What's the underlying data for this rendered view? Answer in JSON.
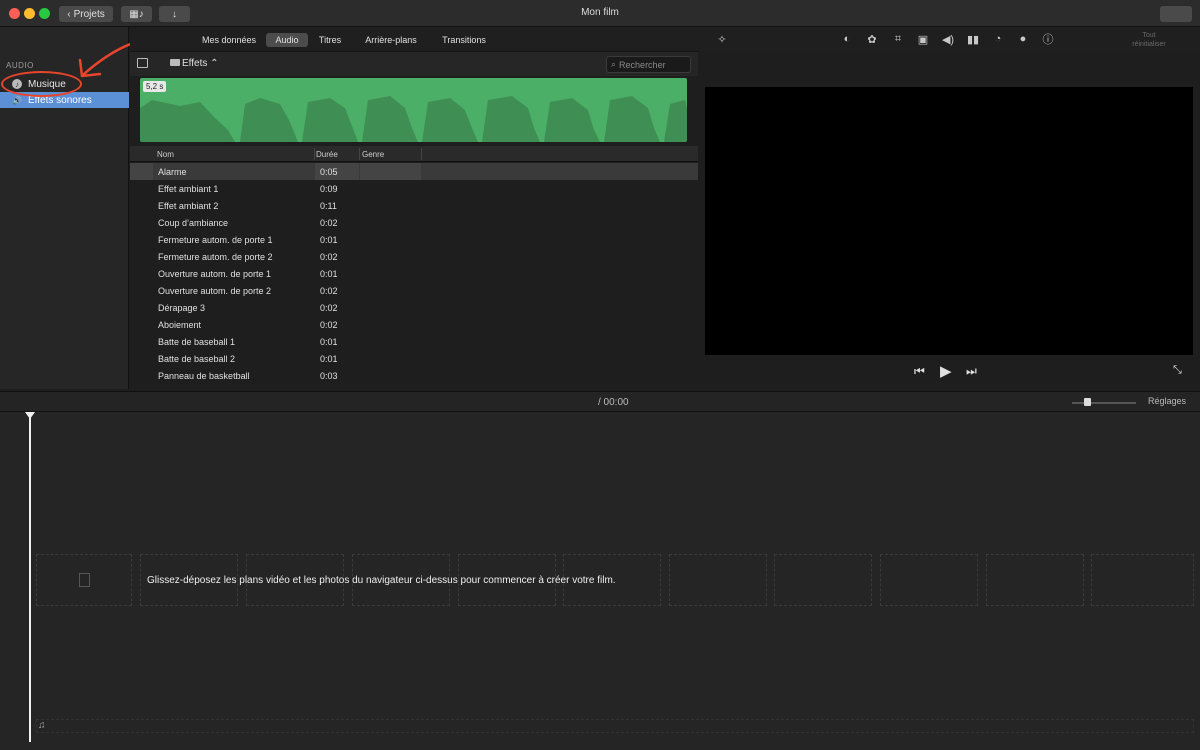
{
  "titlebar": {
    "back_label": "Projets",
    "title": "Mon film"
  },
  "tabs": [
    {
      "label": "Mes données"
    },
    {
      "label": "Audio"
    },
    {
      "label": "Titres"
    },
    {
      "label": "Arrière-plans"
    },
    {
      "label": "Transitions"
    }
  ],
  "sidebar": {
    "section": "AUDIO",
    "items": [
      {
        "label": "Musique"
      },
      {
        "label": "Effets sonores"
      }
    ]
  },
  "browser": {
    "category": "Effets ⌃",
    "search_placeholder": "Rechercher",
    "waveform_duration": "5,2 s"
  },
  "list": {
    "headers": {
      "name": "Nom",
      "duration": "Durée",
      "genre": "Genre"
    },
    "rows": [
      {
        "name": "Alarme",
        "duration": "0:05"
      },
      {
        "name": "Effet ambiant 1",
        "duration": "0:09"
      },
      {
        "name": "Effet ambiant 2",
        "duration": "0:11"
      },
      {
        "name": "Coup d’ambiance",
        "duration": "0:02"
      },
      {
        "name": "Fermeture autom. de porte 1",
        "duration": "0:01"
      },
      {
        "name": "Fermeture autom. de porte 2",
        "duration": "0:02"
      },
      {
        "name": "Ouverture autom. de porte 1",
        "duration": "0:01"
      },
      {
        "name": "Ouverture autom. de porte 2",
        "duration": "0:02"
      },
      {
        "name": "Dérapage 3",
        "duration": "0:02"
      },
      {
        "name": "Aboiement",
        "duration": "0:02"
      },
      {
        "name": "Batte de baseball 1",
        "duration": "0:01"
      },
      {
        "name": "Batte de baseball 2",
        "duration": "0:01"
      },
      {
        "name": "Panneau de basketball",
        "duration": "0:03"
      }
    ]
  },
  "viewer_tools": {
    "reset_label": "Tout réinitialiser"
  },
  "timeline": {
    "timecode": "/ 00:00",
    "settings_label": "Réglages",
    "drop_text": "Glissez-déposez les plans vidéo et les photos du navigateur ci-dessus pour commencer à créer votre film."
  },
  "colors": {
    "accent_selection": "#5b8fd6",
    "waveform": "#4caf67",
    "annotation": "#e8452c"
  }
}
